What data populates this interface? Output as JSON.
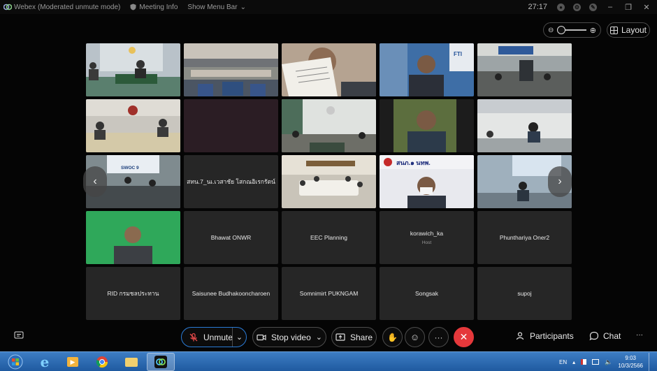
{
  "titlebar": {
    "app_name": "Webex",
    "mode": "(Moderated unmute mode)",
    "meeting_info": "Meeting Info",
    "show_menu": "Show Menu Bar",
    "timer": "27:17"
  },
  "controls": {
    "layout_label": "Layout"
  },
  "grid": {
    "row4": [
      {
        "name": "Bhawat ONWR"
      },
      {
        "name": "EEC Planning"
      },
      {
        "name": "korawich_ka",
        "role": "Host"
      },
      {
        "name": "Phunthariya Oner2"
      }
    ],
    "row5": [
      {
        "name": "RID กรมชลประทาน"
      },
      {
        "name": "Saisunee Budhakooncharoen"
      },
      {
        "name": "Somnimirt PUKNGAM"
      },
      {
        "name": "Songsak"
      },
      {
        "name": "supoj"
      }
    ],
    "row3_name": "สทน.7_นเ.เวสาชัย โสกณอิเรกรัตน์",
    "video_labels": {
      "fti": "FTI",
      "swoc": "SWOC 9",
      "snk": "สนภ.๑ นทพ."
    }
  },
  "toolbar": {
    "unmute": "Unmute",
    "stop_video": "Stop video",
    "share": "Share",
    "more": "···",
    "participants": "Participants",
    "chat": "Chat",
    "overflow": "···"
  },
  "taskbar": {
    "lang": "EN",
    "time": "9:03",
    "date": "10/3/2566"
  }
}
